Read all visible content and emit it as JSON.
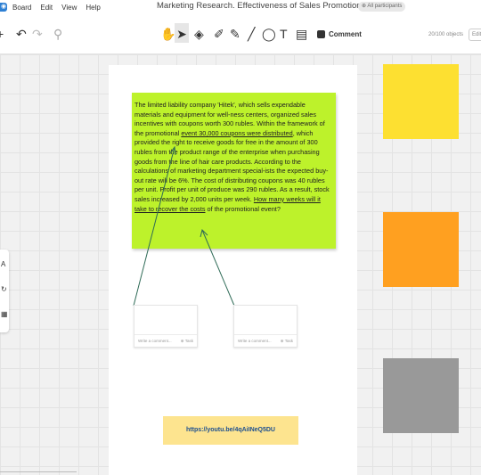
{
  "menubar": {
    "items": [
      "Board",
      "Edit",
      "View",
      "Help"
    ],
    "doc_title": "Marketing Research. Effectiveness of Sales Promotion Products",
    "participants": "All participants"
  },
  "toolbar": {
    "comment_label": "Comment",
    "object_count": "20/100 objects",
    "edit_label": "Edit"
  },
  "note": {
    "part1": "The limited liability company 'Hitek', which sells expendable materials and equipment for well-ness centers, organized sales incentives with coupons worth 300 rubles. Within the framework of the promotional ",
    "underline1": "event 30,000 coupons were distributed",
    "part2": ", which provided the right to receive goods for free in the amount of 300 rubles from the product range of the enterprise when purchasing goods from the line of hair care products. According to the calculations of marketing department special-ists the expected buy-out rate will be 6%. The cost of distributing coupons was 40 rubles per unit. Profit per unit of produce was 290 rubles. As a result, stock sales increased by 2,000 units per week. ",
    "underline2": "How many weeks will it take to recover the costs",
    "part3": " of the promotional event?"
  },
  "cards": [
    {
      "comment_placeholder": "Write a comment...",
      "task_label": "Task"
    },
    {
      "comment_placeholder": "Write a comment...",
      "task_label": "Task"
    }
  ],
  "link_note": {
    "text": "https://youtu.be/4qAiINeQ5DU"
  },
  "colors": {
    "note_green": "#bdf22b",
    "sticky_yellow": "#fde031",
    "sticky_orange": "#ffa020",
    "sticky_gray": "#999999",
    "link_note_bg": "#fde48f",
    "connector": "#2f6b57"
  }
}
